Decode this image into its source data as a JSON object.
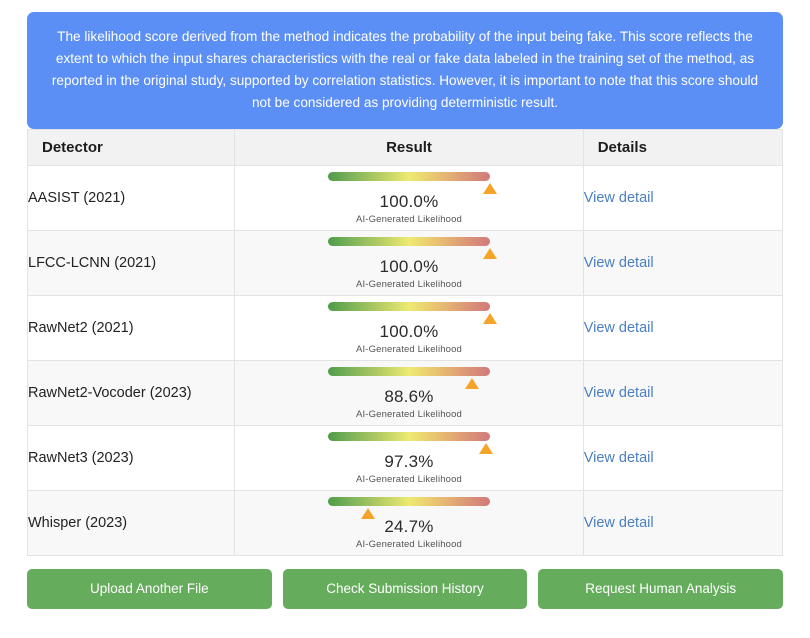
{
  "notice": {
    "text": "The likelihood score derived from the method indicates the probability of the input being fake. This score reflects the extent to which the input shares characteristics with the real or fake data labeled in the training set of the method, as reported in the original study, supported by correlation statistics. However, it is important to note that this score should not be considered as providing deterministic result.",
    "background_color": "#5b8ff5",
    "text_color": "#ffffff"
  },
  "table": {
    "columns": {
      "detector": "Detector",
      "result": "Result",
      "details": "Details"
    },
    "gauge_caption": "AI-Generated Likelihood",
    "rows": [
      {
        "detector": "AASIST (2021)",
        "score_label": "100.0%",
        "score_value": 100.0,
        "caption": "AI-Generated Likelihood",
        "detail_link": "View detail"
      },
      {
        "detector": "LFCC-LCNN (2021)",
        "score_label": "100.0%",
        "score_value": 100.0,
        "caption": "AI-Generated Likelihood",
        "detail_link": "View detail"
      },
      {
        "detector": "RawNet2 (2021)",
        "score_label": "100.0%",
        "score_value": 100.0,
        "caption": "AI-Generated Likelihood",
        "detail_link": "View detail"
      },
      {
        "detector": "RawNet2-Vocoder (2023)",
        "score_label": "88.6%",
        "score_value": 88.6,
        "caption": "AI-Generated Likelihood",
        "detail_link": "View detail"
      },
      {
        "detector": "RawNet3 (2023)",
        "score_label": "97.3%",
        "score_value": 97.3,
        "caption": "AI-Generated Likelihood",
        "detail_link": "View detail"
      },
      {
        "detector": "Whisper (2023)",
        "score_label": "24.7%",
        "score_value": 24.7,
        "caption": "AI-Generated Likelihood",
        "detail_link": "View detail"
      }
    ]
  },
  "actions": [
    {
      "label": "Upload Another File"
    },
    {
      "label": "Check Submission History"
    },
    {
      "label": "Request Human Analysis"
    }
  ],
  "colors": {
    "accent_blue": "#5b8ff5",
    "link_blue": "#4a7fc1",
    "button_green": "#65ad5c",
    "pointer_orange": "#f5a42a",
    "gauge_low": "#4f9b4a",
    "gauge_mid": "#edea72",
    "gauge_high": "#d1797b"
  }
}
